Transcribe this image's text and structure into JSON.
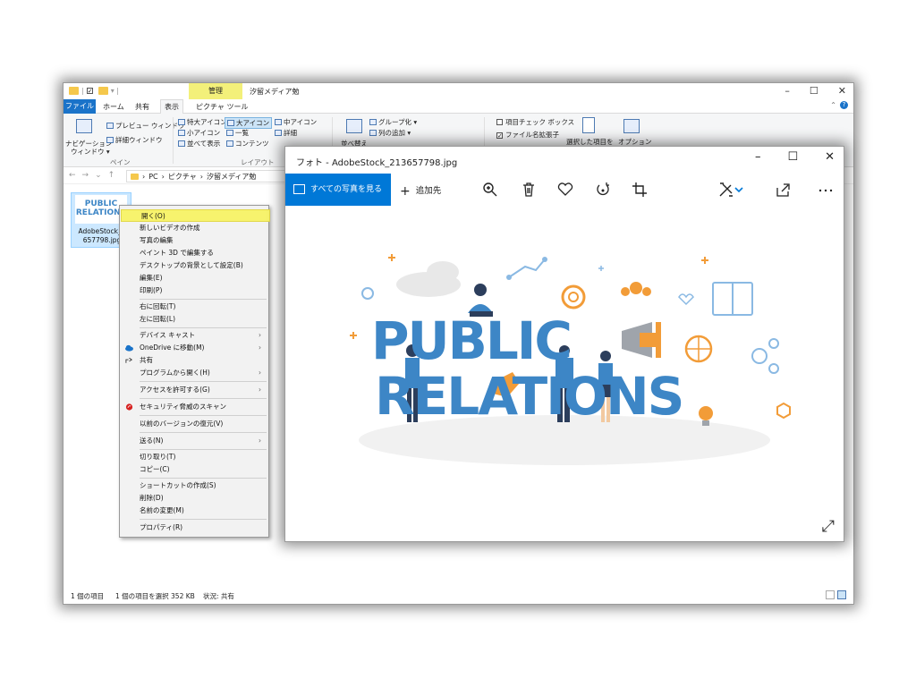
{
  "explorer": {
    "title": "汐留メディア勉",
    "manage_tab": "管理",
    "menu": {
      "file": "ファイル",
      "home": "ホーム",
      "share": "共有",
      "view": "表示",
      "picture_tools": "ピクチャ ツール"
    },
    "ribbon": {
      "preview_pane": "プレビュー ウィンドウ",
      "details_pane": "詳細ウィンドウ",
      "nav_pane_1": "ナビゲーション",
      "nav_pane_2": "ウィンドウ ▾",
      "pane_group": "ペイン",
      "extra_large_icons": "特大アイコン",
      "large_icons": "大アイコン",
      "medium_icons": "中アイコン",
      "small_icons": "小アイコン",
      "list": "一覧",
      "details": "詳細",
      "tiles": "並べて表示",
      "content": "コンテンツ",
      "layout_group": "レイアウト",
      "group_by": "グループ化 ▾",
      "add_columns": "列の追加 ▾",
      "sort_by": "並べ替え",
      "item_check_boxes": "項目チェック ボックス",
      "file_name_extensions": "ファイル名拡張子",
      "hide_selected": "選択した項目を",
      "options": "オプション"
    },
    "breadcrumb": [
      "PC",
      "ピクチャ",
      "汐留メディア勉"
    ],
    "file": {
      "name_line1": "AdobeStock_2",
      "name_line2": "657798.jpg",
      "thumb_line1": "PUBLIC",
      "thumb_line2": "RELATIONS"
    },
    "status": {
      "items": "1 個の項目",
      "selected": "1 個の項目を選択 352 KB",
      "state": "状況: 共有"
    }
  },
  "context_menu": {
    "items": [
      "開く(O)",
      "新しいビデオの作成",
      "写真の編集",
      "ペイント 3D で編集する",
      "デスクトップの背景として設定(B)",
      "編集(E)",
      "印刷(P)",
      "右に回転(T)",
      "左に回転(L)",
      "デバイス キャスト",
      "OneDrive に移動(M)",
      "共有",
      "プログラムから開く(H)",
      "アクセスを許可する(G)",
      "セキュリティ脅威のスキャン",
      "以前のバージョンの復元(V)",
      "送る(N)",
      "切り取り(T)",
      "コピー(C)",
      "ショートカットの作成(S)",
      "削除(D)",
      "名前の変更(M)",
      "プロパティ(R)"
    ]
  },
  "photos": {
    "title": "フォト - AdobeStock_213657798.jpg",
    "see_all": "すべての写真を見る",
    "add_to": "追加先",
    "image": {
      "line1": "PUBLIC",
      "line2": "RELATIONS"
    },
    "accent": "#0078d7"
  }
}
